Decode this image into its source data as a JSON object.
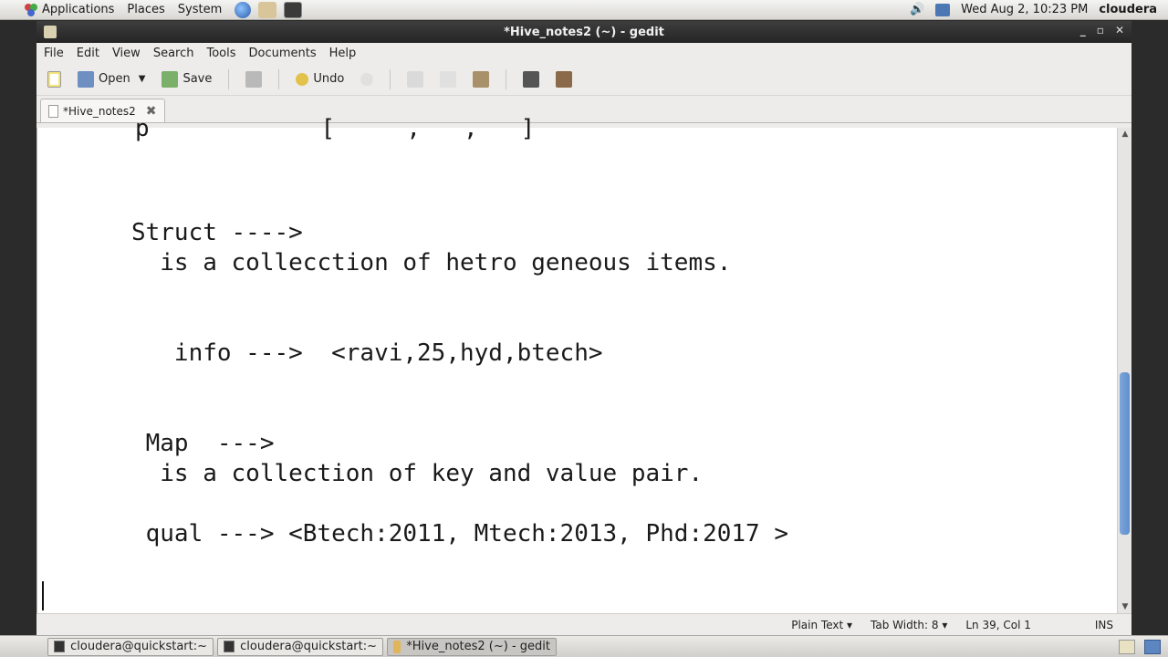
{
  "top_panel": {
    "menus": [
      "Applications",
      "Places",
      "System"
    ],
    "clock": "Wed Aug  2, 10:23 PM",
    "user": "cloudera"
  },
  "window": {
    "title": "*Hive_notes2 (~) - gedit",
    "menubar": [
      "File",
      "Edit",
      "View",
      "Search",
      "Tools",
      "Documents",
      "Help"
    ],
    "toolbar": {
      "open": "Open",
      "save": "Save",
      "undo": "Undo"
    },
    "tab": {
      "label": "*Hive_notes2"
    }
  },
  "editor": {
    "lines": [
      "",
      "",
      "",
      "   Struct ---->",
      "     is a collecction of hetro geneous items.",
      "",
      "",
      "      info --->  <ravi,25,hyd,btech>",
      "",
      "",
      "    Map  --->",
      "     is a collection of key and value pair.",
      "",
      "    qual ---> <Btech:2011, Mtech:2013, Phd:2017 >",
      "",
      "",
      ""
    ]
  },
  "statusbar": {
    "language": "Plain Text ▾",
    "tab_width": "Tab Width:  8 ▾",
    "position": "Ln 39, Col 1",
    "mode": "INS"
  },
  "taskbar": {
    "items": [
      "cloudera@quickstart:~",
      "cloudera@quickstart:~",
      "*Hive_notes2 (~) - gedit"
    ]
  }
}
